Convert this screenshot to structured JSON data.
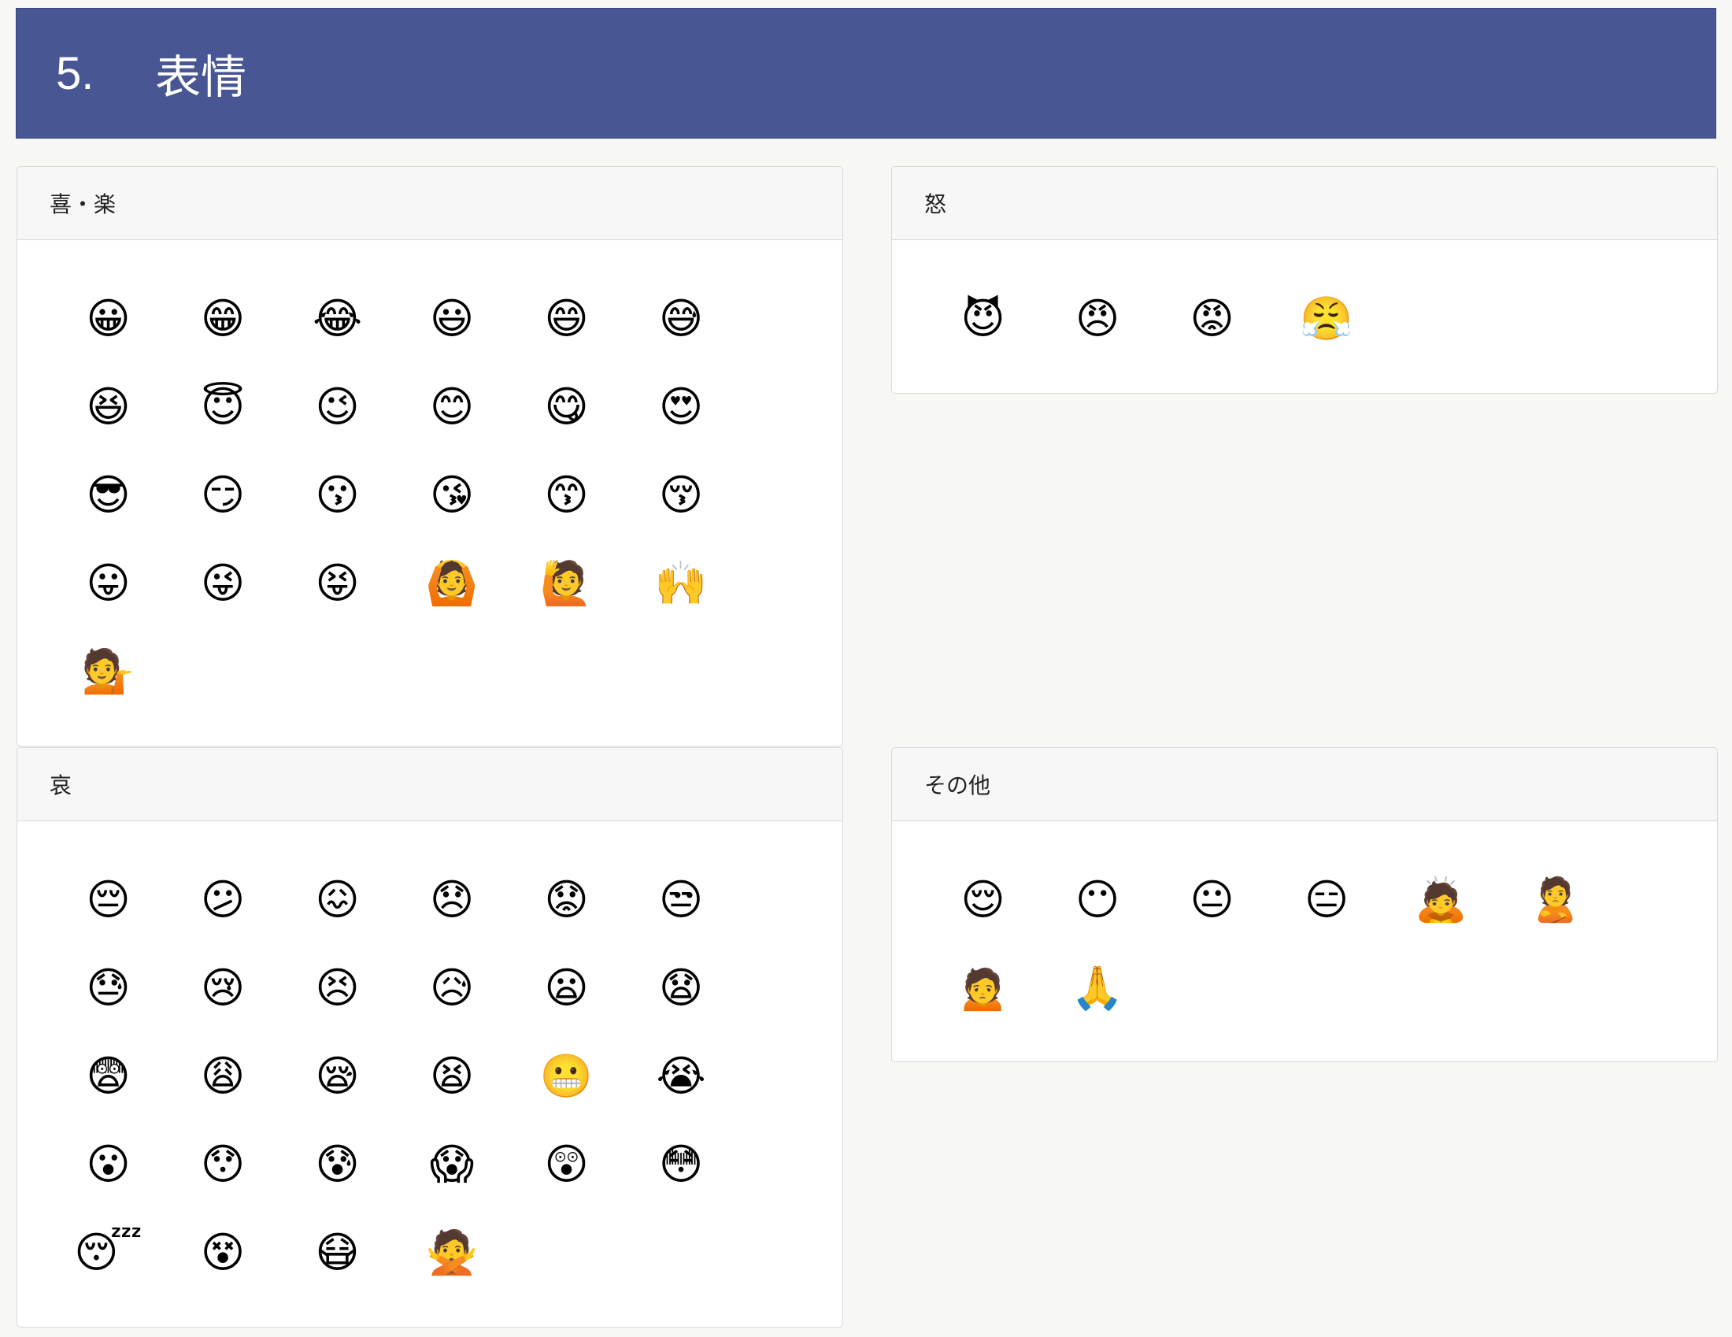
{
  "header": {
    "number": "5.",
    "title": "表情"
  },
  "panels": {
    "joy": {
      "title": "喜・楽",
      "emojis": [
        "😀",
        "😁",
        "😂",
        "😃",
        "😄",
        "😅",
        "😆",
        "😇",
        "😉",
        "😊",
        "😋",
        "😍",
        "😎",
        "😏",
        "😗",
        "😘",
        "😙",
        "😚",
        "😛",
        "😜",
        "😝",
        "🙆",
        "🙋",
        "🙌",
        "💁"
      ]
    },
    "anger": {
      "title": "怒",
      "emojis": [
        "😈",
        "😠",
        "😡",
        "😤"
      ]
    },
    "sad": {
      "title": "哀",
      "emojis": [
        "😔",
        "😕",
        "😖",
        "😞",
        "😟",
        "😒",
        "😓",
        "😢",
        "😣",
        "😥",
        "😦",
        "😧",
        "😨",
        "😩",
        "😪",
        "😫",
        "😬",
        "😭",
        "😮",
        "😯",
        "😰",
        "😱",
        "😲",
        "😳",
        "😴",
        "😵",
        "😷",
        "🙅"
      ]
    },
    "other": {
      "title": "その他",
      "emojis": [
        "😌",
        "😶",
        "😐",
        "😑",
        "🙇",
        "🙎",
        "🙍",
        "🙏"
      ]
    }
  }
}
